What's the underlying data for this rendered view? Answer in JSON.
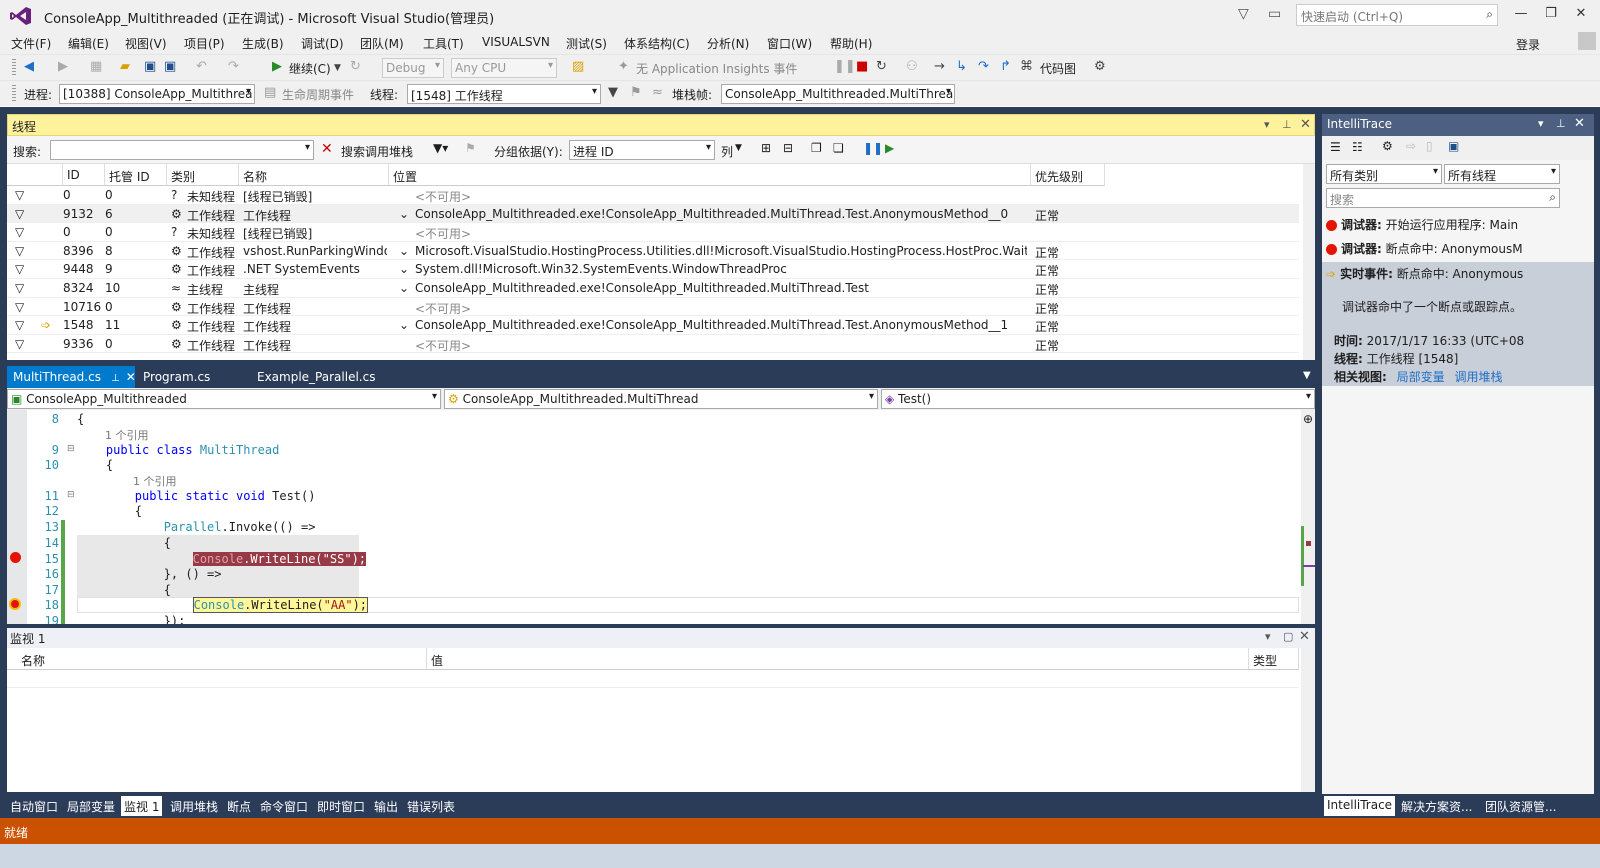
{
  "window": {
    "title": "ConsoleApp_Multithreaded (正在调试) - Microsoft Visual Studio(管理员)",
    "quick_launch_placeholder": "快速启动 (Ctrl+Q)",
    "login": "登录"
  },
  "menu": [
    "文件(F)",
    "编辑(E)",
    "视图(V)",
    "项目(P)",
    "生成(B)",
    "调试(D)",
    "团队(M)",
    "工具(T)",
    "VISUALSVN",
    "测试(S)",
    "体系结构(C)",
    "分析(N)",
    "窗口(W)",
    "帮助(H)"
  ],
  "toolbar1": {
    "continue": "继续(C)",
    "config": "Debug",
    "platform": "Any CPU",
    "insights": "无 Application Insights 事件",
    "codemap": "代码图"
  },
  "toolbar2": {
    "process_label": "进程:",
    "process": "[10388] ConsoleApp_Multithrea",
    "lifecycle": "生命周期事件",
    "thread_label": "线程:",
    "thread": "[1548] 工作线程",
    "stackframe_label": "堆栈帧:",
    "stackframe": "ConsoleApp_Multithreaded.MultiThrea"
  },
  "threads": {
    "title": "线程",
    "search_label": "搜索:",
    "search_callstack": "搜索调用堆栈",
    "group_label": "分组依据(Y):",
    "group_value": "进程 ID",
    "columns_btn": "列",
    "headers": [
      "ID",
      "托管 ID",
      "类别",
      "名称",
      "位置",
      "优先级别"
    ],
    "rows": [
      {
        "id": "0",
        "mid": "0",
        "cat": "未知线程",
        "name": "[线程已销毁]",
        "loc": "<不可用>",
        "pri": "",
        "na": true
      },
      {
        "id": "9132",
        "mid": "6",
        "cat": "工作线程",
        "name": "工作线程",
        "loc": "ConsoleApp_Multithreaded.exe!ConsoleApp_Multithreaded.MultiThread.Test.AnonymousMethod__0",
        "pri": "正常"
      },
      {
        "id": "0",
        "mid": "0",
        "cat": "未知线程",
        "name": "[线程已销毁]",
        "loc": "<不可用>",
        "pri": "",
        "na": true
      },
      {
        "id": "8396",
        "mid": "8",
        "cat": "工作线程",
        "name": "vshost.RunParkingWindow",
        "loc": "Microsoft.VisualStudio.HostingProcess.Utilities.dll!Microsoft.VisualStudio.HostingProcess.HostProc.WaitForThreadExit",
        "pri": "正常"
      },
      {
        "id": "9448",
        "mid": "9",
        "cat": "工作线程",
        "name": ".NET SystemEvents",
        "loc": "System.dll!Microsoft.Win32.SystemEvents.WindowThreadProc",
        "pri": "正常"
      },
      {
        "id": "8324",
        "mid": "10",
        "cat": "主线程",
        "name": "主线程",
        "loc": "ConsoleApp_Multithreaded.exe!ConsoleApp_Multithreaded.MultiThread.Test",
        "pri": "正常"
      },
      {
        "id": "10716",
        "mid": "0",
        "cat": "工作线程",
        "name": "工作线程",
        "loc": "<不可用>",
        "pri": "正常",
        "na": true
      },
      {
        "id": "1548",
        "mid": "11",
        "cat": "工作线程",
        "name": "工作线程",
        "loc": "ConsoleApp_Multithreaded.exe!ConsoleApp_Multithreaded.MultiThread.Test.AnonymousMethod__1",
        "pri": "正常",
        "current": true
      },
      {
        "id": "9336",
        "mid": "0",
        "cat": "工作线程",
        "name": "工作线程",
        "loc": "<不可用>",
        "pri": "正常",
        "na": true
      }
    ]
  },
  "editor": {
    "tabs": [
      "MultiThread.cs",
      "Program.cs",
      "Example_Parallel.cs"
    ],
    "nav": [
      "ConsoleApp_Multithreaded",
      "ConsoleApp_Multithreaded.MultiThread",
      "Test()"
    ],
    "refs": "1 个引用"
  },
  "watch": {
    "title": "监视 1",
    "headers": [
      "名称",
      "值",
      "类型"
    ]
  },
  "bottom_tabs": [
    "自动窗口",
    "局部变量",
    "监视 1",
    "调用堆栈",
    "断点",
    "命令窗口",
    "即时窗口",
    "输出",
    "错误列表"
  ],
  "intellitrace": {
    "title": "IntelliTrace",
    "filter1": "所有类别",
    "filter2": "所有线程",
    "search_placeholder": "搜索",
    "events": [
      {
        "kind": "调试器:",
        "text": "开始运行应用程序: Main"
      },
      {
        "kind": "调试器:",
        "text": "断点命中: AnonymousM"
      },
      {
        "kind": "实时事件:",
        "text": "断点命中: Anonymous"
      }
    ],
    "detail": "调试器命中了一个断点或跟踪点。",
    "time_label": "时间:",
    "time": "2017/1/17 16:33 (UTC+08",
    "thread_label": "线程:",
    "thread": "工作线程 [1548]",
    "views_label": "相关视图:",
    "view1": "局部变量",
    "view2": "调用堆栈"
  },
  "right_tabs": [
    "IntelliTrace",
    "解决方案资...",
    "团队资源管..."
  ],
  "status": "就绪"
}
